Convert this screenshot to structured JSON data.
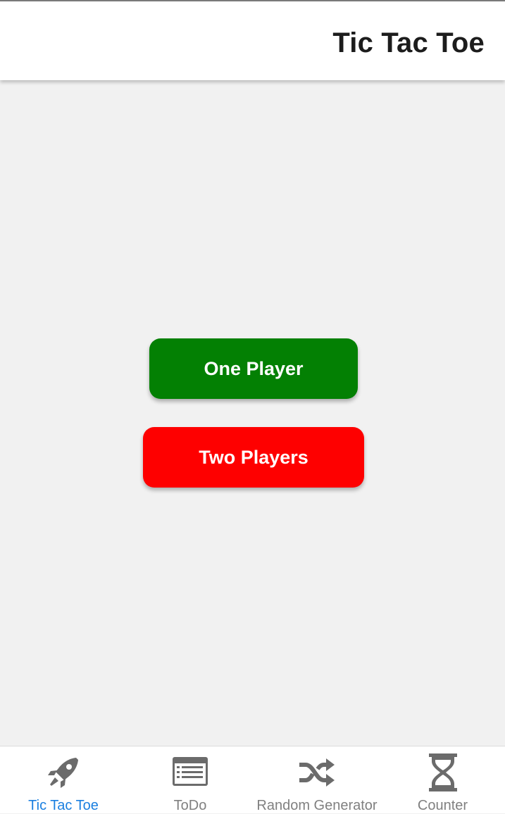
{
  "header": {
    "title": "Tic Tac Toe"
  },
  "main": {
    "one_player_label": "One Player",
    "two_players_label": "Two Players"
  },
  "tabs": [
    {
      "label": "Tic Tac Toe",
      "icon": "rocket-icon",
      "active": true
    },
    {
      "label": "ToDo",
      "icon": "list-icon",
      "active": false
    },
    {
      "label": "Random Generator",
      "icon": "shuffle-icon",
      "active": false
    },
    {
      "label": "Counter",
      "icon": "hourglass-icon",
      "active": false
    }
  ],
  "colors": {
    "one_player_button": "#038003",
    "two_players_button": "#fe0000",
    "active_tab": "#1a7fe0",
    "inactive_tab": "#808080",
    "icon": "#6b6b6b",
    "background": "#f1f1f1"
  }
}
